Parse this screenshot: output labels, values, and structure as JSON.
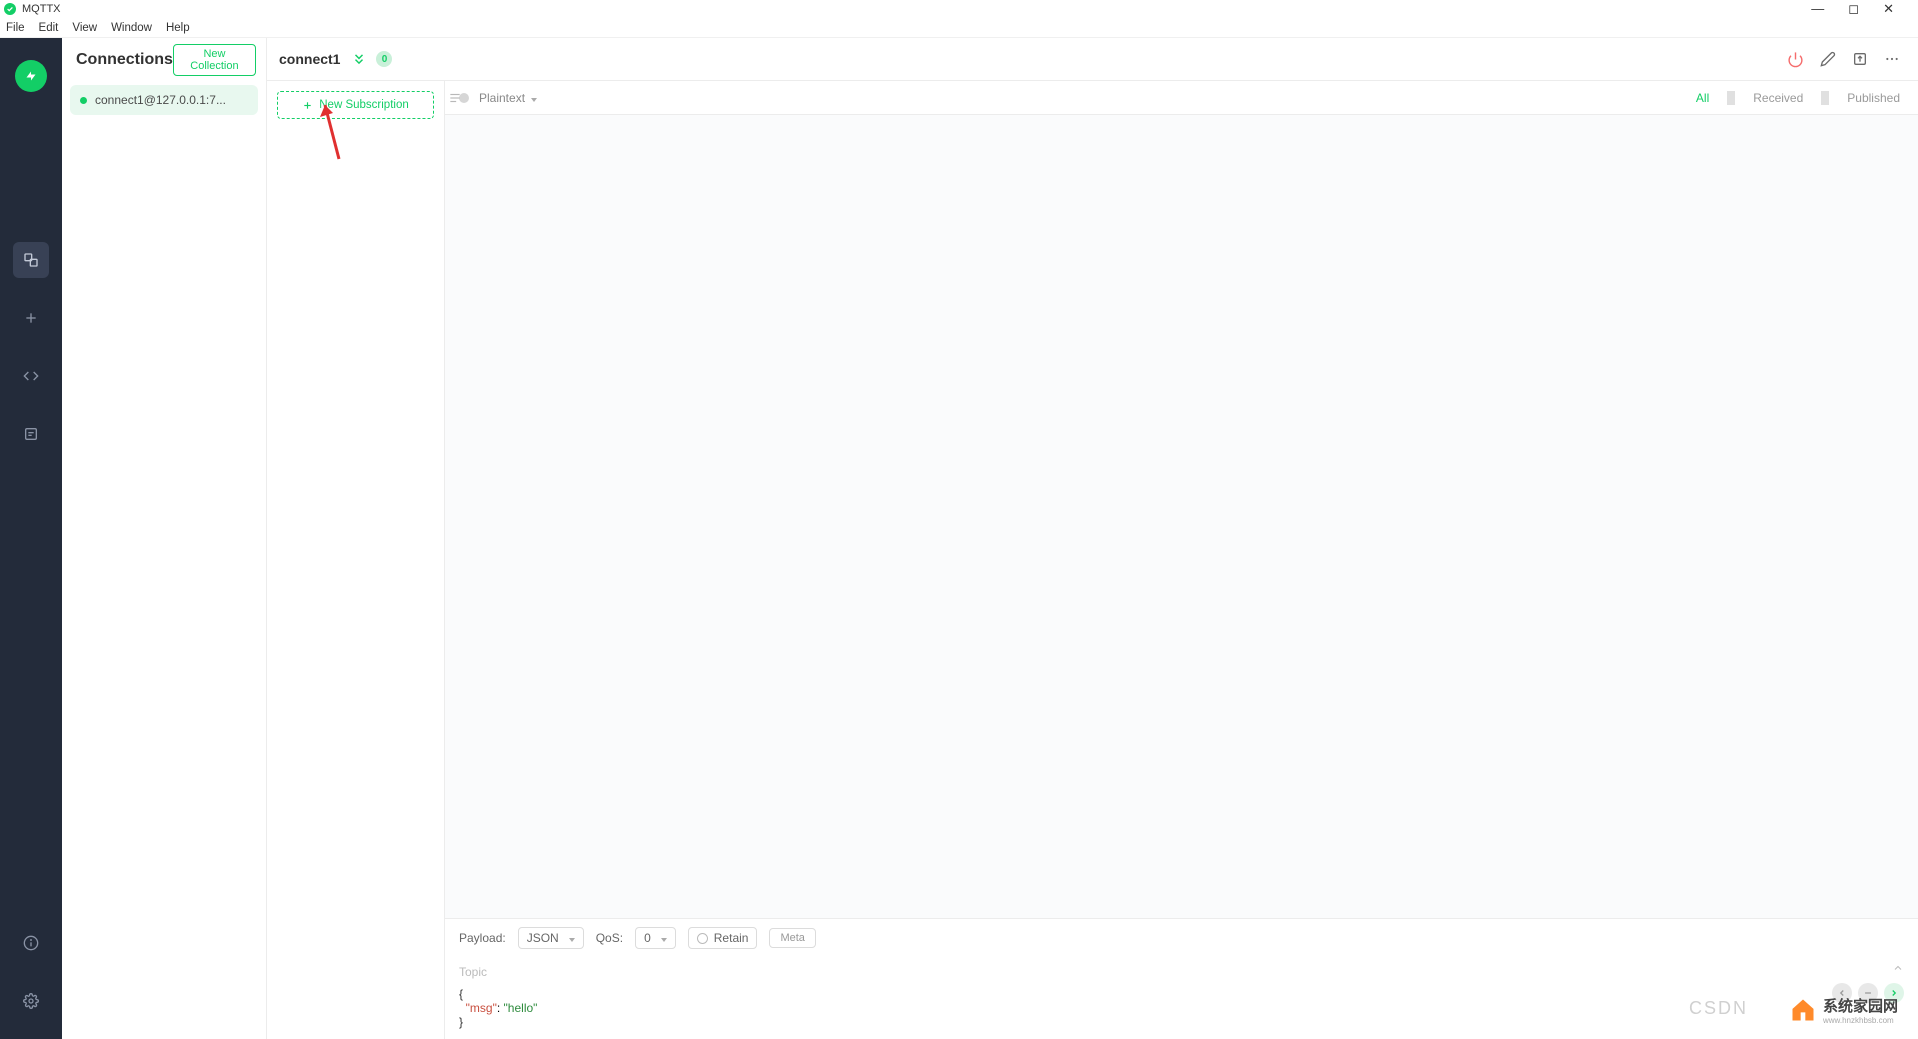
{
  "window": {
    "title": "MQTTX"
  },
  "menubar": [
    "File",
    "Edit",
    "View",
    "Window",
    "Help"
  ],
  "panel": {
    "title": "Connections",
    "new_collection_label": "New Collection",
    "connections": [
      {
        "name": "connect1@127.0.0.1:7...",
        "connected": true
      }
    ]
  },
  "header": {
    "connection_name": "connect1",
    "subscription_count": "0"
  },
  "subscriptions": {
    "new_button_label": "New Subscription"
  },
  "messages": {
    "format_label": "Plaintext",
    "filters": [
      "All",
      "Received",
      "Published"
    ],
    "active_filter": "All"
  },
  "publish": {
    "payload_label": "Payload:",
    "payload_format": "JSON",
    "qos_label": "QoS:",
    "qos_value": "0",
    "retain_label": "Retain",
    "meta_label": "Meta",
    "topic_placeholder": "Topic",
    "topic_value": "",
    "payload_lines": {
      "l1": "{",
      "l2_key": "\"msg\"",
      "l2_colon": ": ",
      "l2_val": "\"hello\"",
      "l3": "}"
    }
  },
  "watermarks": {
    "csdn": "CSDN",
    "site_cn": "系统家园网",
    "site_url": "www.hnzkhbsb.com"
  }
}
